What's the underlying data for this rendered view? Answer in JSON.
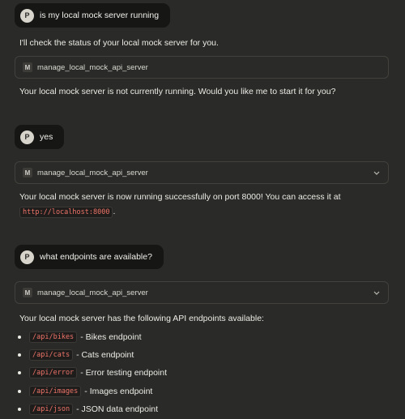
{
  "conversation": {
    "messages": [
      {
        "role": "user",
        "avatar": "P",
        "text": "is my local mock server running"
      },
      {
        "role": "assistant",
        "text": "I'll check the status of your local mock server for you."
      },
      {
        "role": "tool",
        "icon": "M",
        "name": "manage_local_mock_api_server"
      },
      {
        "role": "assistant",
        "text": "Your local mock server is not currently running. Would you like me to start it for you?"
      },
      {
        "role": "user",
        "avatar": "P",
        "text": "yes"
      },
      {
        "role": "tool",
        "icon": "M",
        "name": "manage_local_mock_api_server"
      },
      {
        "role": "assistant",
        "text": "Your local mock server is now running successfully on port 8000! You can access it at",
        "code": "http://localhost:8000",
        "suffix": "."
      },
      {
        "role": "user",
        "avatar": "P",
        "text": "what endpoints are available?"
      },
      {
        "role": "tool",
        "icon": "M",
        "name": "manage_local_mock_api_server"
      },
      {
        "role": "assistant",
        "text": "Your local mock server has the following API endpoints available:"
      }
    ],
    "endpoints": [
      {
        "path": "/api/bikes",
        "description": "- Bikes endpoint"
      },
      {
        "path": "/api/cats",
        "description": "- Cats endpoint"
      },
      {
        "path": "/api/error",
        "description": "- Error testing endpoint"
      },
      {
        "path": "/api/images",
        "description": "- Images endpoint"
      },
      {
        "path": "/api/json",
        "description": "- JSON data endpoint"
      }
    ]
  },
  "icons": {
    "tool_card_expand": "chevron-down-icon"
  },
  "colors": {
    "background": "#2a2a28",
    "user_bubble": "#161615",
    "code_text": "#ef7468",
    "card_border": "#42413d"
  }
}
